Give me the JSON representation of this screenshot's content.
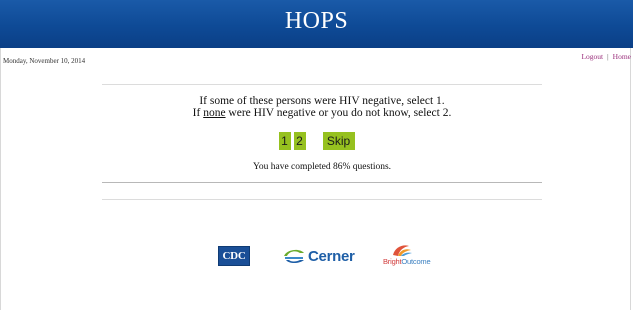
{
  "header": {
    "title": "HOPS"
  },
  "date": "Monday, November 10, 2014",
  "toplinks": {
    "logout": "Logout",
    "separator": "|",
    "home": "Home"
  },
  "question": {
    "line1": "If some of these persons were HIV negative, select 1.",
    "line2_prefix": "If ",
    "line2_underlined": "none",
    "line2_suffix": " were HIV negative or you do not know, select 2."
  },
  "answers": {
    "option1": "1",
    "option2": "2",
    "skip": "Skip"
  },
  "progress_text": "You have completed 86% questions.",
  "logos": {
    "cdc": "CDC",
    "cerner": "Cerner",
    "brightoutcome_a": "Bright",
    "brightoutcome_b": "Outcome"
  },
  "colors": {
    "header": "#0e4a96",
    "answer_button": "#96c11f",
    "link": "#9b2f7c"
  }
}
